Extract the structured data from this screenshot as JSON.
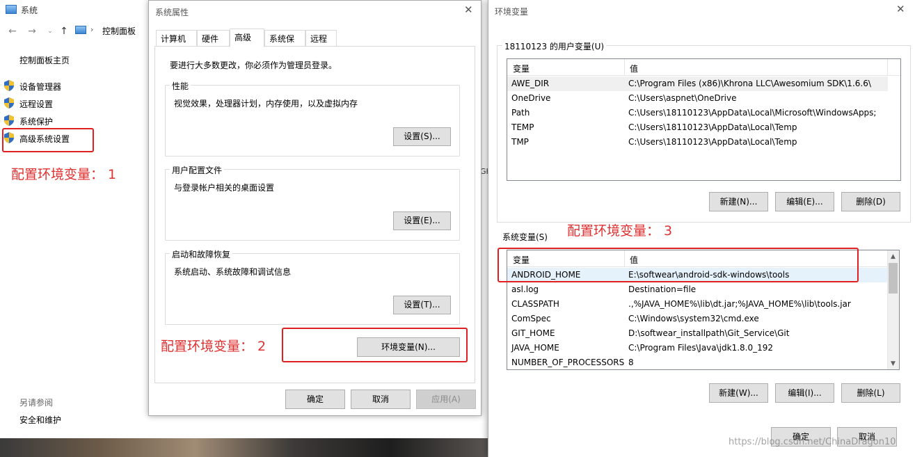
{
  "control_panel": {
    "title": "系统",
    "breadcrumb": "控制面板",
    "home_link": "控制面板主页",
    "items": [
      {
        "label": "设备管理器"
      },
      {
        "label": "远程设置"
      },
      {
        "label": "系统保护"
      },
      {
        "label": "高级系统设置"
      }
    ],
    "annotation": "配置环境变量： 1",
    "see_also": "另请参阅",
    "security": "安全和维护",
    "strip_text": "GH"
  },
  "system_properties": {
    "title": "系统属性",
    "tabs": [
      "计算机名",
      "硬件",
      "高级",
      "系统保护",
      "远程"
    ],
    "active_tab": "高级",
    "admin_note": "要进行大多数更改，你必须作为管理员登录。",
    "groups": [
      {
        "title": "性能",
        "desc": "视觉效果，处理器计划，内存使用，以及虚拟内存",
        "button": "设置(S)..."
      },
      {
        "title": "用户配置文件",
        "desc": "与登录帐户相关的桌面设置",
        "button": "设置(E)..."
      },
      {
        "title": "启动和故障恢复",
        "desc": "系统启动、系统故障和调试信息",
        "button": "设置(T)..."
      }
    ],
    "env_button": "环境变量(N)...",
    "annotation": "配置环境变量： 2",
    "ok": "确定",
    "cancel": "取消",
    "apply": "应用(A)"
  },
  "env_vars": {
    "title": "环境变量",
    "user_label": "18110123 的用户变量(U)",
    "col_var": "变量",
    "col_val": "值",
    "user_rows": [
      {
        "name": "AWE_DIR",
        "value": "C:\\Program Files (x86)\\Khrona LLC\\Awesomium SDK\\1.6.6\\"
      },
      {
        "name": "OneDrive",
        "value": "C:\\Users\\aspnet\\OneDrive"
      },
      {
        "name": "Path",
        "value": "C:\\Users\\18110123\\AppData\\Local\\Microsoft\\WindowsApps;"
      },
      {
        "name": "TEMP",
        "value": "C:\\Users\\18110123\\AppData\\Local\\Temp"
      },
      {
        "name": "TMP",
        "value": "C:\\Users\\18110123\\AppData\\Local\\Temp"
      }
    ],
    "user_buttons": {
      "new": "新建(N)...",
      "edit": "编辑(E)...",
      "delete": "删除(D)"
    },
    "sys_label": "系统变量(S)",
    "annotation": "配置环境变量： 3",
    "sys_rows": [
      {
        "name": "ANDROID_HOME",
        "value": "E:\\softwear\\android-sdk-windows\\tools"
      },
      {
        "name": "asl.log",
        "value": "Destination=file"
      },
      {
        "name": "CLASSPATH",
        "value": ".,%JAVA_HOME%\\lib\\dt.jar;%JAVA_HOME%\\lib\\tools.jar"
      },
      {
        "name": "ComSpec",
        "value": "C:\\Windows\\system32\\cmd.exe"
      },
      {
        "name": "GIT_HOME",
        "value": "D:\\softwear_installpath\\Git_Service\\Git"
      },
      {
        "name": "JAVA_HOME",
        "value": "C:\\Program Files\\Java\\jdk1.8.0_192"
      },
      {
        "name": "NUMBER_OF_PROCESSORS",
        "value": "8"
      }
    ],
    "sys_buttons": {
      "new": "新建(W)...",
      "edit": "编辑(I)...",
      "delete": "删除(L)"
    },
    "ok": "确定",
    "cancel": "取消",
    "watermark": "https://blog.csdn.net/ChinaDragon10"
  },
  "colors": {
    "annotation_red": "#e03030",
    "selection": "#e5f1fb"
  }
}
